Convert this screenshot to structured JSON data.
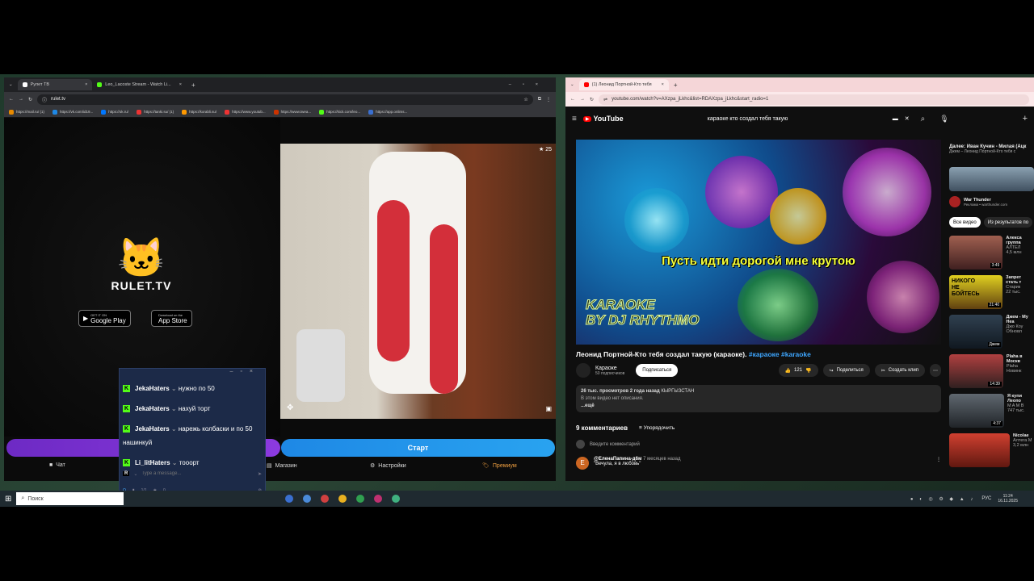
{
  "left_browser": {
    "tabs": [
      {
        "label": "Рулет ТВ"
      },
      {
        "label": "Leo_Lacoste Stream - Watch Li..."
      }
    ],
    "url": "rulet.tv",
    "bookmarks": [
      "https://mail.ru/ (1)",
      "https://vk.com/id19...",
      "https://ok.ru/",
      "https://tanki.su/ (1)",
      "https://korabli.su/",
      "https://www.youtub...",
      "https://www.twea...",
      "https://kick.com/leo...",
      "https://app.onlims..."
    ],
    "brand": "RULET.TV",
    "stores": {
      "google_pre": "GET IT ON",
      "google": "Google Play",
      "apple_pre": "Download on the",
      "apple": "App Store"
    },
    "cam_badge": "25",
    "start_button": "Старт",
    "nav": {
      "chat": "Чат",
      "shop": "Магазин",
      "settings": "Настройки",
      "premium": "Премиум"
    }
  },
  "chat": {
    "messages": [
      {
        "user": "JekaHaters",
        "text": "нужно по 50"
      },
      {
        "user": "JekaHaters",
        "text": "нахуй торт"
      },
      {
        "user": "JekaHaters",
        "text": "нарежь колбаски и по 50 нашинкуй"
      },
      {
        "user": "Li_litHaters",
        "text": "тооорт"
      }
    ],
    "placeholder": "Type a message...",
    "stats": {
      "users": "1/1",
      "views": "0"
    }
  },
  "right_browser": {
    "tab": "(1) Леонид Портной-Кто тебя",
    "url": "youtube.com/watch?v=AXzpa_jLkhc&list=RDAXzpa_jLkhc&start_radio=1",
    "yt_logo": "YouTube",
    "search": "караоке кто создал тебя такую",
    "lyric": "Пусть идти дорогой мне крутою",
    "karaoke_brand_1": "KARAOKE",
    "karaoke_brand_2": "BY DJ RHYTHMO",
    "title": "Леонид Портной-Кто тебя создал такую (караоке).",
    "hashtags": "#караоке #karaoke",
    "channel": "Караоке",
    "subs": "50 подписчиков",
    "subscribe": "Подписаться",
    "likes": "121",
    "share": "Поделиться",
    "clip": "Создать клип",
    "views": "26 тыс. просмотров",
    "ago": "2 года назад",
    "country": "КЫРГЫЗСТАН",
    "no_desc": "В этом видео нет описания.",
    "more": "...ещё",
    "comments_count": "9 комментариев",
    "sort": "Упорядочить",
    "add_comment": "Введите комментарий",
    "comment_author": "@ЕленаПапина-д6м",
    "comment_time": "7 месяцев назад",
    "comment_text": "\"Вечула, я в любовь\"",
    "next_label": "Далее: Иван Кучин - Милая (Ацк",
    "next_sub": "Джем – Леонид Портной-Кто тебя с",
    "ad_title": "War Thunder",
    "ad_sub": "Реклама • warthunder.com",
    "filter_all": "Все видео",
    "filter_results": "Из результатов по",
    "side_videos": [
      {
        "title": "Алекса группа",
        "sub": "АЛТЕЛ",
        "meta": "4,5 млн",
        "dur": "3:49"
      },
      {
        "title": "Запрет стать т",
        "sub": "Старик",
        "meta": "22 тыс.",
        "dur": "21:40"
      },
      {
        "title": "Джем - My Hea",
        "sub": "Джо Коу",
        "meta": "Обновл",
        "dur": "Джем"
      },
      {
        "title": "Plaha в Москв",
        "sub": "Plaha",
        "meta": "Новинк",
        "dur": "14:39"
      },
      {
        "title": "Я купи Леопо",
        "sub": "M A M B",
        "meta": "747 тыс.",
        "dur": "4:37"
      },
      {
        "title": "Nicolae",
        "sub": "Алтега М",
        "meta": "3,2 млн",
        "dur": ""
      }
    ],
    "thumb_text": "НИКОГО НЕ БОЙТЕСЬ"
  },
  "taskbar": {
    "search": "Поиск",
    "lang": "РУС",
    "time": "11:24",
    "date": "16.11.2025"
  }
}
